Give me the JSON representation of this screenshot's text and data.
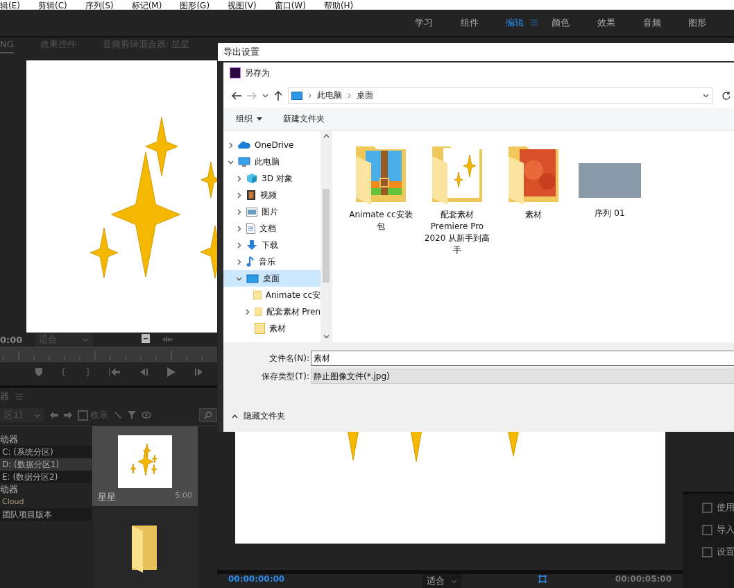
{
  "menu_bar": {
    "items": [
      "辑(E)",
      "剪辑(C)",
      "序列(S)",
      "标记(M)",
      "图形(G)",
      "视图(V)",
      "窗口(W)",
      "帮助(H)"
    ]
  },
  "workspaces": [
    {
      "label": "学习",
      "selected": false
    },
    {
      "label": "组件",
      "selected": false
    },
    {
      "label": "编辑",
      "selected": true
    },
    {
      "label": "颜色",
      "selected": false
    },
    {
      "label": "效果",
      "selected": false
    },
    {
      "label": "音频",
      "selected": false
    },
    {
      "label": "图形",
      "selected": false
    }
  ],
  "source_panel": {
    "tabs": [
      {
        "label": "NG",
        "selected": true
      },
      {
        "label": "效果控件",
        "selected": false
      },
      {
        "label": "音频剪辑混合器: 星星",
        "selected": false
      }
    ],
    "timecode": "0:00",
    "zoom": "适合"
  },
  "project_panel": {
    "title": "器",
    "bin_dropdown": "区1)",
    "ingest": {
      "label": "收录",
      "checked": false
    },
    "locations": [
      {
        "label": "动器",
        "kind": "header",
        "selected": false
      },
      {
        "label": "C: (系统分区)",
        "kind": "item",
        "selected": false
      },
      {
        "label": "D: (数据分区1)",
        "kind": "item",
        "selected": true
      },
      {
        "label": "E: (数据分区2)",
        "kind": "item",
        "selected": false
      },
      {
        "label": "动器",
        "kind": "header",
        "selected": false
      },
      {
        "label": "Cloud",
        "kind": "plain",
        "selected": false
      },
      {
        "label": "团队项目版本",
        "kind": "item",
        "selected": false
      }
    ],
    "items": [
      {
        "kind": "clip",
        "name": "星星",
        "duration": "5:00",
        "selected": true
      },
      {
        "kind": "folder",
        "selected": false
      }
    ]
  },
  "program_monitor": {
    "timecode": "00:00:00:00",
    "zoom": "适合",
    "duration": "00:00:05:00"
  },
  "side_panel": {
    "options": [
      {
        "label": "使用",
        "checked": false
      },
      {
        "label": "导入",
        "checked": false
      },
      {
        "label": "设置",
        "checked": false
      }
    ]
  },
  "export_window": {
    "title": "导出设置"
  },
  "save_dialog": {
    "title": "另存为",
    "breadcrumb": [
      "此电脑",
      "桌面"
    ],
    "toolbar": [
      {
        "label": "组织",
        "kind": "menu"
      },
      {
        "label": "新建文件夹",
        "kind": "button"
      }
    ],
    "nav_tree": [
      {
        "label": "OneDrive",
        "kind": "cloud",
        "expanded": false,
        "selected": false
      },
      {
        "label": "此电脑",
        "kind": "pc",
        "expanded": true,
        "selected": false,
        "children": [
          {
            "label": "3D 对象",
            "kind": "cube",
            "expanded": false,
            "selected": false
          },
          {
            "label": "视频",
            "kind": "film",
            "expanded": false,
            "selected": false
          },
          {
            "label": "图片",
            "kind": "picture",
            "expanded": false,
            "selected": false
          },
          {
            "label": "文档",
            "kind": "document",
            "expanded": false,
            "selected": false
          },
          {
            "label": "下载",
            "kind": "download",
            "expanded": false,
            "selected": false
          },
          {
            "label": "音乐",
            "kind": "music",
            "expanded": false,
            "selected": false
          },
          {
            "label": "桌面",
            "kind": "desktop",
            "expanded": true,
            "selected": true,
            "children": [
              {
                "label": "Animate cc安",
                "kind": "folder",
                "selected": false
              },
              {
                "label": "配套素材 Pren",
                "kind": "folder",
                "expanded": false,
                "selected": false
              },
              {
                "label": "素材",
                "kind": "folder",
                "selected": false
              }
            ]
          }
        ]
      }
    ],
    "files": [
      {
        "name": "Animate cc安装包",
        "kind": "zip-folder"
      },
      {
        "name": "配套素材 Premiere Pro 2020 从新手到高手",
        "kind": "star-folder"
      },
      {
        "name": "素材",
        "kind": "photo-folder"
      },
      {
        "name": "序列 01",
        "kind": "image"
      }
    ],
    "file_name": {
      "label": "文件名(N):",
      "value": "素材"
    },
    "save_type": {
      "label": "保存类型(T):",
      "value": "静止图像文件(*.jpg)"
    },
    "hide_folders": "隐藏文件夹"
  }
}
